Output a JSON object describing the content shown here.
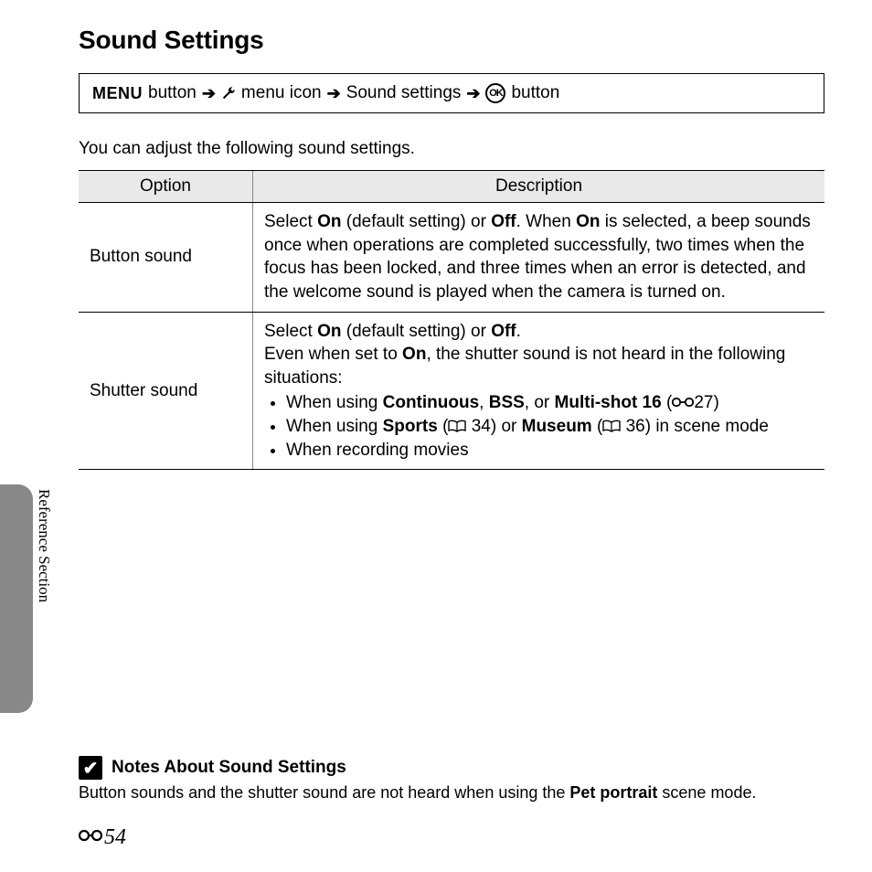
{
  "title": "Sound Settings",
  "nav": {
    "menu": "MENU",
    "button1": "button",
    "menu_icon": "menu icon",
    "sound_settings": "Sound settings",
    "ok": "OK",
    "button2": "button"
  },
  "intro": "You can adjust the following sound settings.",
  "table": {
    "headers": {
      "option": "Option",
      "description": "Description"
    },
    "rows": [
      {
        "option": "Button sound",
        "desc": {
          "pre1": "Select ",
          "b1": "On",
          "mid1": " (default setting) or ",
          "b2": "Off",
          "mid2": ". When ",
          "b3": "On",
          "rest": " is selected, a beep sounds once when operations are completed successfully, two times when the focus has been locked, and three times when an error is detected, and the welcome sound is played when the camera is turned on."
        }
      },
      {
        "option": "Shutter sound",
        "desc2": {
          "l1_pre": "Select ",
          "l1_b1": "On",
          "l1_mid": " (default setting) or ",
          "l1_b2": "Off",
          "l1_end": ".",
          "l2_pre": "Even when set to ",
          "l2_b1": "On",
          "l2_end": ", the shutter sound is not heard in the following situations:",
          "li1_pre": "When using ",
          "li1_b1": "Continuous",
          "li1_sep1": ", ",
          "li1_b2": "BSS",
          "li1_sep2": ", or ",
          "li1_b3": "Multi-shot 16",
          "li1_open": " (",
          "li1_ref": "27",
          "li1_close": ")",
          "li2_pre": "When using ",
          "li2_b1": "Sports",
          "li2_open1": " (",
          "li2_ref1": " 34",
          "li2_close1": ") or ",
          "li2_b2": "Museum",
          "li2_open2": " (",
          "li2_ref2": " 36",
          "li2_close2": ") in scene mode",
          "li3": "When recording movies"
        }
      }
    ]
  },
  "side_label": "Reference Section",
  "notes": {
    "heading": "Notes About Sound Settings",
    "body_pre": "Button sounds and the shutter sound are not heard when using the ",
    "body_b": "Pet portrait",
    "body_post": " scene mode."
  },
  "page_number": "54"
}
